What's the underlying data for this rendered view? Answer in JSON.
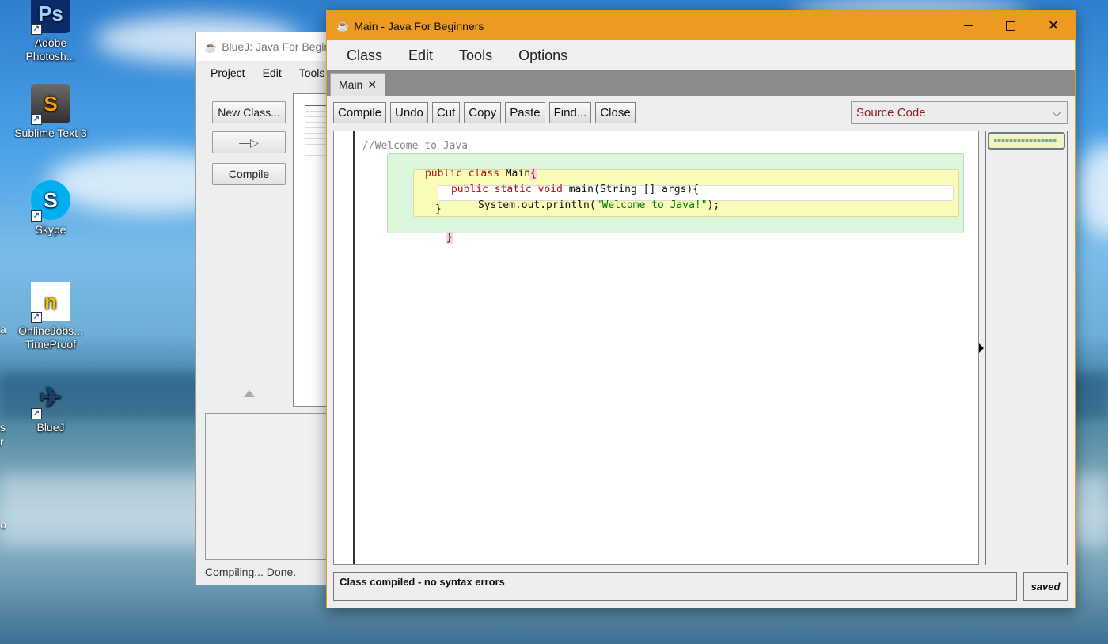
{
  "desktop": {
    "icons": [
      {
        "label": "Adobe Photosh...",
        "icon": "photoshop-icon",
        "glyph": "Ps",
        "color": "#0a2a6a"
      },
      {
        "label": "Sublime Text 3",
        "icon": "sublime-text-icon",
        "glyph": "S",
        "color": "#4a4a4a"
      },
      {
        "label": "Skype",
        "icon": "skype-icon",
        "glyph": "S",
        "color": "#00aff0"
      },
      {
        "label": "OnlineJobs... TimeProof",
        "icon": "timeproof-icon",
        "glyph": "n",
        "color": "#ffffff"
      },
      {
        "label": "BlueJ",
        "icon": "bluej-bird-icon",
        "glyph": "✈",
        "color": "#1e3d6b"
      }
    ],
    "edge_fragments": [
      "a",
      "s",
      "r",
      "o"
    ]
  },
  "bluej_window": {
    "title": "BlueJ:  Java For Beginners",
    "menu": [
      "Project",
      "Edit",
      "Tools"
    ],
    "buttons": {
      "new_class": "New Class...",
      "arrow": "—▷",
      "compile": "Compile"
    },
    "status": "Compiling... Done."
  },
  "editor": {
    "title": "Main - Java For Beginners",
    "window_controls": {
      "minimize": "minimize",
      "maximize": "maximize",
      "close": "✕"
    },
    "menu": [
      "Class",
      "Edit",
      "Tools",
      "Options"
    ],
    "tab": {
      "label": "Main",
      "close": "✕"
    },
    "toolbar": [
      "Compile",
      "Undo",
      "Cut",
      "Copy",
      "Paste",
      "Find...",
      "Close"
    ],
    "view_select": {
      "selected": "Source Code",
      "chevron": "⌵"
    },
    "code": {
      "comment": "//Welcome to Java",
      "line2_kw1": "public",
      "line2_kw2": "class",
      "line2_name": "Main",
      "open_brace": "{",
      "line3_kw1": "public",
      "line3_kw2": "static",
      "line3_kw3": "void",
      "line3_rest": "main(String [] args){",
      "line4_pre": "System.out.println(",
      "line4_str": "\"Welcome to Java!\"",
      "line4_post": ");",
      "line5": "}",
      "line6": "}"
    },
    "message": "Class compiled - no syntax errors",
    "saved_label": "saved"
  },
  "colors": {
    "editor_titlebar": "#ec9a22",
    "keyword": "#aa1111",
    "string": "#007a00",
    "comment": "#888888",
    "class_scope": "#dcf6dc",
    "method_scope": "#fbfbb9",
    "source_code_text": "#9b1b1b"
  }
}
